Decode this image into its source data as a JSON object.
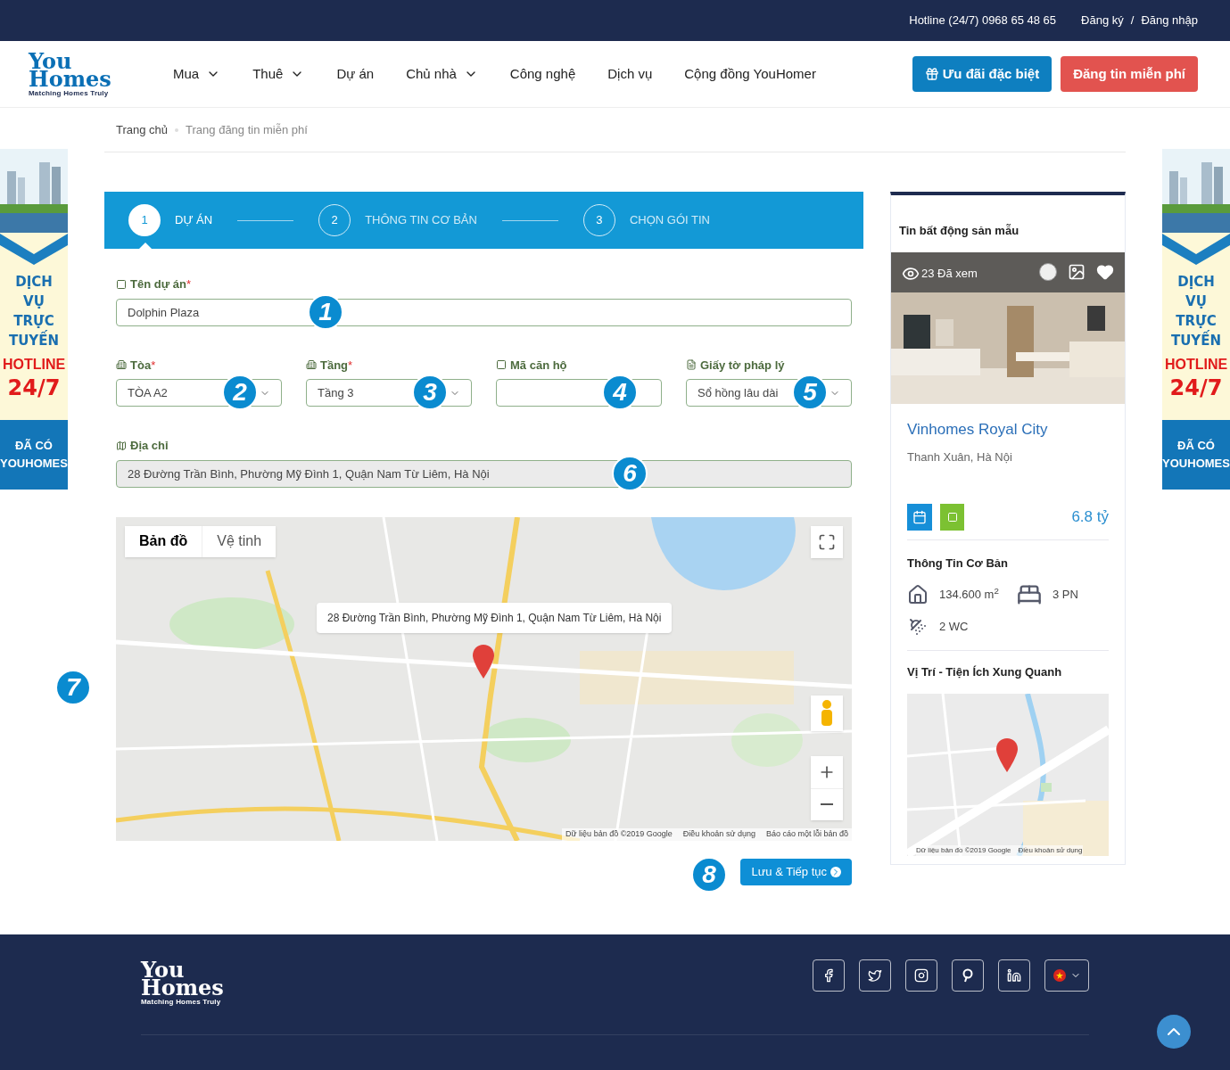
{
  "top_bar": {
    "hotline": "Hotline (24/7) 0968 65 48 65",
    "register": "Đăng ký",
    "separator": "/",
    "login": "Đăng nhập"
  },
  "header": {
    "logo": {
      "line1": "You",
      "line2": "Homes",
      "tagline": "Matching Homes Truly"
    },
    "nav": [
      {
        "label": "Mua",
        "dropdown": true
      },
      {
        "label": "Thuê",
        "dropdown": true
      },
      {
        "label": "Dự án",
        "dropdown": false
      },
      {
        "label": "Chủ nhà",
        "dropdown": true
      },
      {
        "label": "Công nghệ",
        "dropdown": false
      },
      {
        "label": "Dịch vụ",
        "dropdown": false
      },
      {
        "label": "Cộng đồng YouHomer",
        "dropdown": false
      }
    ],
    "buttons": [
      {
        "label": "Ưu đãi đặc biệt",
        "kind": "primary"
      },
      {
        "label": "Đăng tin miễn phí",
        "kind": "danger"
      }
    ]
  },
  "breadcrumb": [
    "Trang chủ",
    "Trang đăng tin miễn phí"
  ],
  "side_banners": [
    {
      "lines": [
        "DỊCH",
        "VỤ",
        "TRỰC",
        "TUYẾN"
      ],
      "hotline": "HOTLINE",
      "hours": "24/7",
      "footer": [
        "ĐÃ CÓ",
        "YOUHOMES"
      ]
    },
    {
      "lines": [
        "DỊCH",
        "VỤ",
        "TRỰC",
        "TUYẾN"
      ],
      "hotline": "HOTLINE",
      "hours": "24/7",
      "footer": [
        "ĐÃ CÓ",
        "YOUHOMES"
      ]
    }
  ],
  "steps": [
    {
      "number": "1",
      "label": "DỰ ÁN",
      "selected": true
    },
    {
      "number": "2",
      "label": "THÔNG TIN CƠ BẢN",
      "selected": false
    },
    {
      "number": "3",
      "label": "CHỌN GÓI TIN",
      "selected": false
    }
  ],
  "project_field": {
    "label": "Tên dự án",
    "required_mark": "*",
    "value": "Dolphin Plaza",
    "marker": "1"
  },
  "detail_fields": [
    {
      "kind": "select",
      "label": "Tòa",
      "required_mark": "*",
      "value": "TÒA A2",
      "marker": "2"
    },
    {
      "kind": "select",
      "label": "Tầng",
      "required_mark": "*",
      "value": "Tầng 3",
      "marker": "3"
    },
    {
      "kind": "text",
      "label": "Mã căn hộ",
      "marker": "4"
    },
    {
      "kind": "select",
      "label": "Giấy tờ pháp lý",
      "value": "Sổ hồng lâu dài",
      "marker": "5"
    }
  ],
  "address_field": {
    "label": "Địa chỉ",
    "value": "28 Đường Trần Bình, Phường Mỹ Đình 1, Quận Nam Từ Liêm, Hà Nội",
    "marker": "6"
  },
  "map": {
    "marker": "7",
    "tabs": [
      {
        "label": "Bản đồ",
        "selected": true
      },
      {
        "label": "Vệ tinh",
        "selected": false
      }
    ],
    "info": "28 Đường Trần Bình, Phường Mỹ Đình 1, Quận Nam Từ Liêm, Hà Nội",
    "attribution": [
      "Dữ liệu bản đồ ©2019 Google",
      "Điều khoản sử dụng",
      "Báo cáo một lỗi bản đồ"
    ]
  },
  "submit": {
    "label": "Lưu & Tiếp tục",
    "marker": "8"
  },
  "sidebar": {
    "title": "Tin bất động sản mẫu",
    "views": "23 Đã xem",
    "name": "Vinhomes Royal City",
    "location": "Thanh Xuân, Hà Nội",
    "price": "6.8 tỷ",
    "basic_title": "Thông Tin Cơ Bản",
    "area": "134.600 m$^{2}$",
    "bedrooms": "3 PN",
    "bathrooms": "2 WC",
    "location_title": "Vị Trí - Tiện Ích Xung Quanh",
    "map_attribution": [
      "Dữ liệu bản đồ ©2019 Google",
      "Điều khoản sử dụng"
    ]
  },
  "footer": {
    "logo": {
      "line1": "You",
      "line2": "Homes",
      "tagline": "Matching Homes Truly"
    }
  }
}
